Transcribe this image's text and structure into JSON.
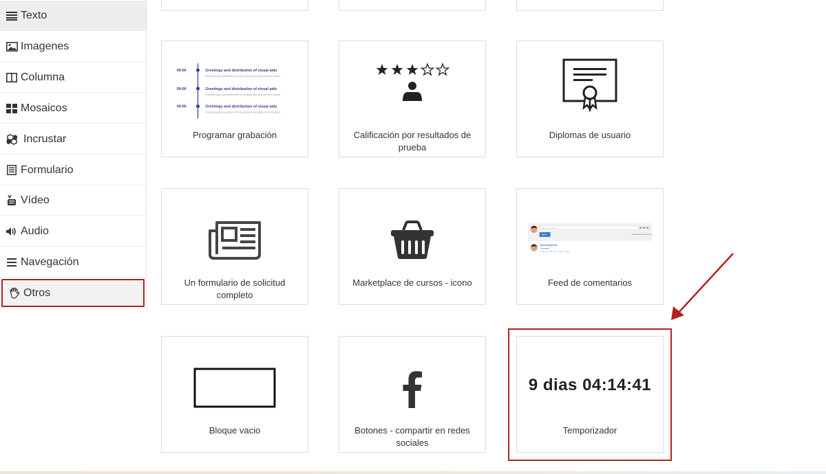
{
  "sidebar": {
    "items": [
      {
        "label": "Texto",
        "icon": "list-icon"
      },
      {
        "label": "Imagenes",
        "icon": "image-icon"
      },
      {
        "label": "Columna",
        "icon": "columns-icon"
      },
      {
        "label": "Mosaicos",
        "icon": "grid-icon"
      },
      {
        "label": "Incrustar",
        "icon": "cubes-icon"
      },
      {
        "label": "Formulario",
        "icon": "form-icon"
      },
      {
        "label": "Vídeo",
        "icon": "youtube-icon"
      },
      {
        "label": "Audio",
        "icon": "volume-icon"
      },
      {
        "label": "Navegación",
        "icon": "bars-icon"
      },
      {
        "label": "Otros",
        "icon": "hand-icon"
      }
    ]
  },
  "schedule_preview": {
    "rows": [
      {
        "time": "09:00",
        "title": "Greetings and distribution of visual aids",
        "desc": "Everyone gets acquainted with the program and gets into their places"
      },
      {
        "time": "09:00",
        "title": "Greetings and distribution of visual aids",
        "desc": "Everyone gets acquainted with the program and gets into their places"
      },
      {
        "time": "09:00",
        "title": "Greetings and distribution of visual aids",
        "desc": "Everyone gets acquainted with the program and gets into their places"
      }
    ]
  },
  "feed_preview": {
    "input_placeholder": "Write a comment",
    "button": "Send",
    "link": "Subscribe to discussion",
    "author": "Anna Boyarova",
    "text": "Comment",
    "meta": "15 de jun 15:45 · Like · Reply · Report"
  },
  "timer": {
    "value": "9 dias 04:14:41"
  },
  "cards": [
    {
      "label": "Programar grabación"
    },
    {
      "label": "Calificación por resultados de prueba"
    },
    {
      "label": "Diplomas de usuario"
    },
    {
      "label": "Un formulario de solicitud completo"
    },
    {
      "label": "Marketplace de cursos - icono"
    },
    {
      "label": "Feed de comentarios"
    },
    {
      "label": "Bloque vacio"
    },
    {
      "label": "Botones - compartir en redes sociales"
    },
    {
      "label": "Temporizador"
    }
  ],
  "colors": {
    "highlight": "#b22222",
    "timeline": "#2b3a8f"
  }
}
